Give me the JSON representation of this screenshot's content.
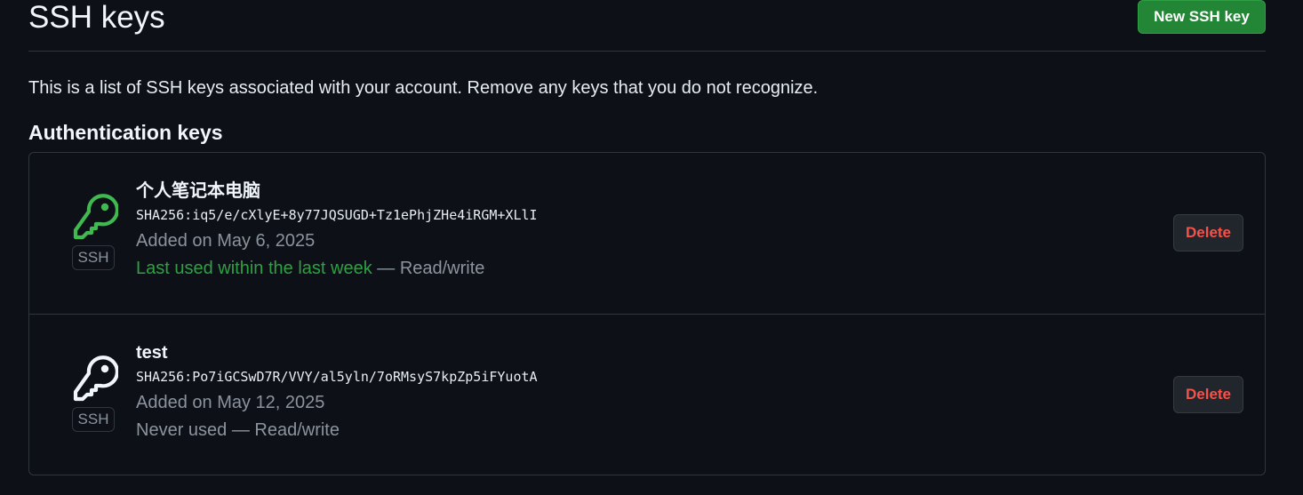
{
  "header": {
    "title": "SSH keys",
    "new_key_label": "New SSH key"
  },
  "intro": "This is a list of SSH keys associated with your account. Remove any keys that you do not recognize.",
  "section_title": "Authentication keys",
  "keys": [
    {
      "title": "个人笔记本电脑",
      "fingerprint": "SHA256:iq5/e/cXlyE+8y77JQSUGD+Tz1ePhjZHe4iRGM+XLlI",
      "added": "Added on May 6, 2025",
      "usage_recent": "Last used within the last week",
      "usage_access": " — Read/write",
      "badge": "SSH",
      "delete_label": "Delete",
      "icon": "key-icon",
      "icon_color": "#3fb950"
    },
    {
      "title": "test",
      "fingerprint": "SHA256:Po7iGCSwD7R/VVY/al5yln/7oRMsyS7kpZp5iFYuotA",
      "added": "Added on May 12, 2025",
      "usage_recent": "",
      "usage_access": "Never used — Read/write",
      "badge": "SSH",
      "delete_label": "Delete",
      "icon": "key-icon",
      "icon_color": "#f0f6fc"
    }
  ],
  "colors": {
    "background": "#0d1117",
    "primary_button": "#238636",
    "danger": "#f85149",
    "recent_usage": "#2ea043",
    "muted_text": "#8b949e"
  }
}
